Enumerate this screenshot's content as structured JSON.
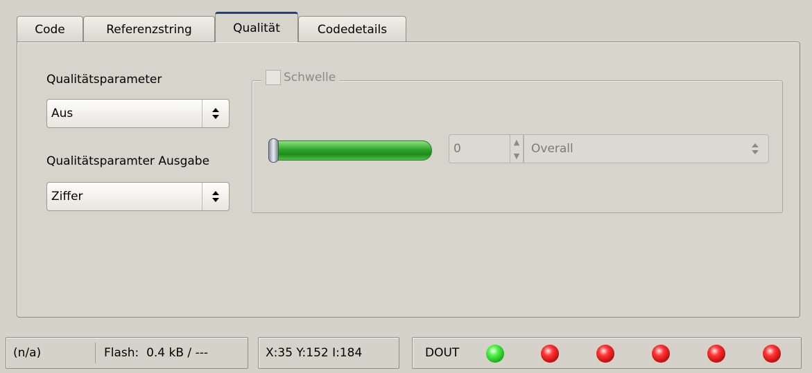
{
  "tabs": [
    {
      "label": "Code",
      "active": false
    },
    {
      "label": "Referenzstring",
      "active": false
    },
    {
      "label": "Qualität",
      "active": true
    },
    {
      "label": "Codedetails",
      "active": false
    }
  ],
  "quality": {
    "param_label": "Qualitätsparameter",
    "param_value": "Aus",
    "output_label": "Qualitätsparamter Ausgabe",
    "output_value": "Ziffer"
  },
  "threshold": {
    "checkbox_label": "Schwelle",
    "enabled": false,
    "slider_level": 0,
    "spin_value": "0",
    "mode_value": "Overall"
  },
  "status": {
    "na": "(n/a)",
    "flash": "Flash:  0.4 kB / ---",
    "coords": "X:35 Y:152 I:184",
    "dout_label": "DOUT",
    "leds": [
      "green",
      "red",
      "red",
      "red",
      "red",
      "red"
    ]
  },
  "icons": {
    "combo_arrows": "up-down-arrows-icon",
    "spin_up": "spin-up-icon",
    "spin_down": "spin-down-icon",
    "led": "led-indicator-icon"
  }
}
